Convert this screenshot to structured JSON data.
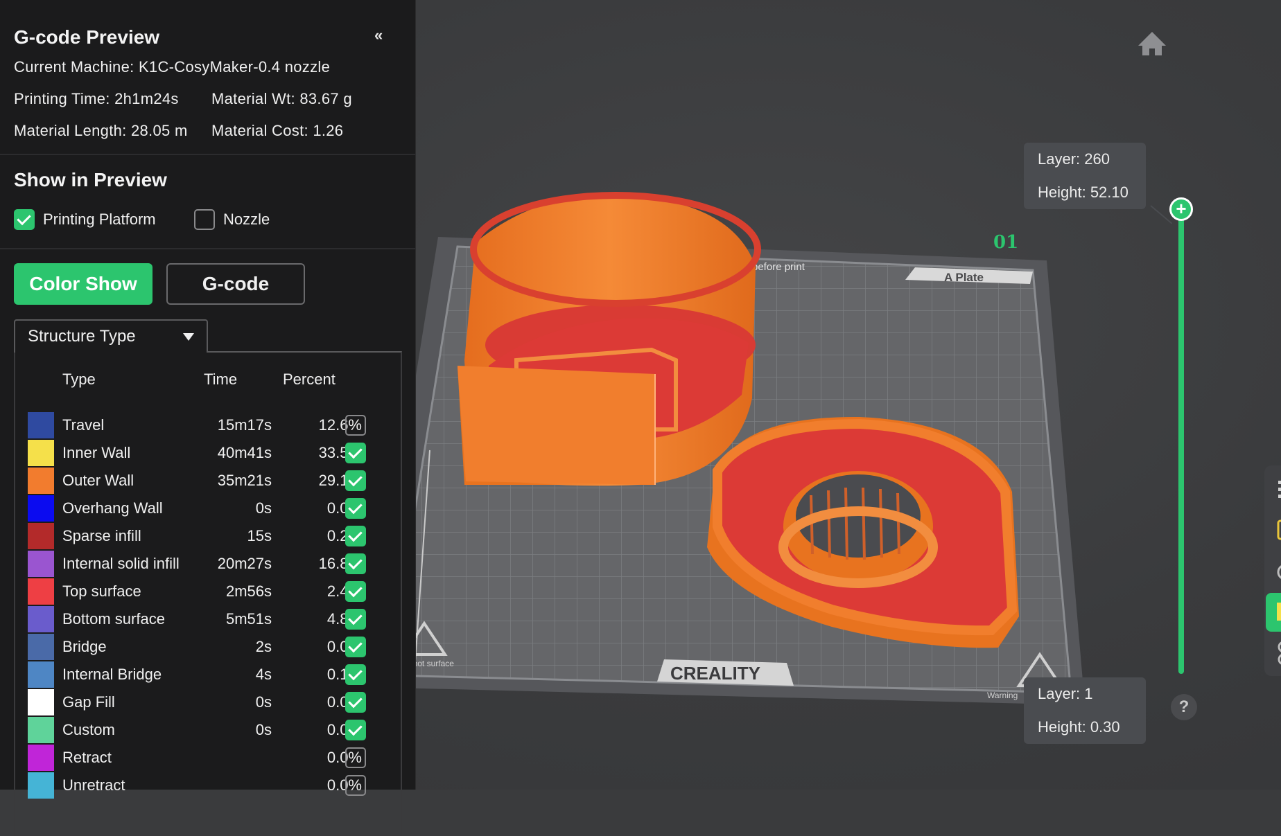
{
  "panel": {
    "title": "G-code Preview",
    "collapse_label": "«",
    "machine": "Current Machine: K1C-CosyMaker-0.4 nozzle",
    "printing_time": "Printing Time: 2h1m24s",
    "material_wt": "Material Wt: 83.67 g",
    "material_length": "Material Length: 28.05 m",
    "material_cost": "Material Cost: 1.26"
  },
  "show_in_preview": {
    "title": "Show in Preview",
    "platform": {
      "label": "Printing Platform",
      "checked": true
    },
    "nozzle": {
      "label": "Nozzle",
      "checked": false
    }
  },
  "mode": {
    "color_show": "Color Show",
    "gcode": "G-code"
  },
  "dropdown": {
    "selected": "Structure Type"
  },
  "legend": {
    "headers": {
      "type": "Type",
      "time": "Time",
      "percent": "Percent"
    },
    "rows": [
      {
        "type": "Travel",
        "time": "15m17s",
        "percent": "12.6%",
        "color": "#2f4aa0",
        "checked": false
      },
      {
        "type": "Inner Wall",
        "time": "40m41s",
        "percent": "33.5%",
        "color": "#f5e04a",
        "checked": true
      },
      {
        "type": "Outer Wall",
        "time": "35m21s",
        "percent": "29.1%",
        "color": "#f27c2e",
        "checked": true
      },
      {
        "type": "Overhang Wall",
        "time": "0s",
        "percent": "0.0%",
        "color": "#0b0bf0",
        "checked": true
      },
      {
        "type": "Sparse infill",
        "time": "15s",
        "percent": "0.2%",
        "color": "#b32a2a",
        "checked": true
      },
      {
        "type": "Internal solid infill",
        "time": "20m27s",
        "percent": "16.8%",
        "color": "#9a55d0",
        "checked": true
      },
      {
        "type": "Top surface",
        "time": "2m56s",
        "percent": "2.4%",
        "color": "#ee3f44",
        "checked": true
      },
      {
        "type": "Bottom surface",
        "time": "5m51s",
        "percent": "4.8%",
        "color": "#6a5ccc",
        "checked": true
      },
      {
        "type": "Bridge",
        "time": "2s",
        "percent": "0.0%",
        "color": "#4a6aa8",
        "checked": true
      },
      {
        "type": "Internal Bridge",
        "time": "4s",
        "percent": "0.1%",
        "color": "#4e86c4",
        "checked": true
      },
      {
        "type": "Gap Fill",
        "time": "0s",
        "percent": "0.0%",
        "color": "#ffffff",
        "checked": true
      },
      {
        "type": "Custom",
        "time": "0s",
        "percent": "0.0%",
        "color": "#5fd39a",
        "checked": true
      },
      {
        "type": "Retract",
        "time": "",
        "percent": "0.0%",
        "color": "#c025d8",
        "checked": false
      },
      {
        "type": "Unretract",
        "time": "",
        "percent": "0.0%",
        "color": "#45b4d6",
        "checked": false
      }
    ]
  },
  "viewport": {
    "plate_number": "01",
    "plate_name": "A Plate",
    "plate_note": "before print",
    "brand": "CREALITY",
    "warning_left": "Warning hot surface",
    "warning_right": "Warning",
    "layer_top": {
      "layer": "Layer: 260",
      "height": "Height: 52.10"
    },
    "layer_bottom": {
      "layer": "Layer: 1",
      "height": "Height: 0.30"
    },
    "help": "?"
  }
}
